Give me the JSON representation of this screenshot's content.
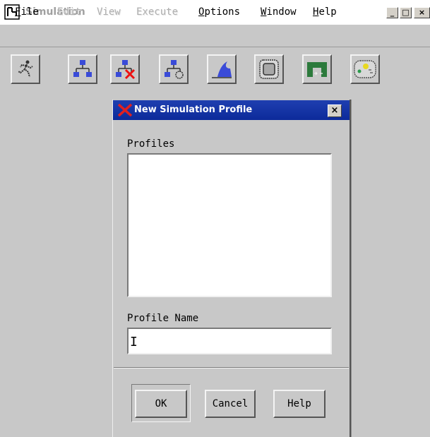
{
  "window": {
    "title": "Simulation",
    "controls": {
      "minimize": "_",
      "maximize": "□",
      "close": "×"
    }
  },
  "menubar": {
    "items": [
      {
        "label": "File",
        "underline": "F",
        "rest": "ile",
        "enabled": true
      },
      {
        "label": "Edit",
        "enabled": false
      },
      {
        "label": "View",
        "enabled": false
      },
      {
        "label": "Execute",
        "enabled": false
      },
      {
        "label": "Options",
        "underline": "O",
        "rest": "ptions",
        "enabled": true
      },
      {
        "label": "Window",
        "underline": "W",
        "rest": "indow",
        "enabled": true
      },
      {
        "label": "Help",
        "underline": "H",
        "rest": "elp",
        "enabled": true
      }
    ]
  },
  "toolbar": {
    "buttons": [
      {
        "icon": "running-man-icon"
      },
      {
        "icon": "hierarchy-icon"
      },
      {
        "icon": "hierarchy-delete-icon"
      },
      {
        "icon": "hierarchy-edit-icon"
      },
      {
        "icon": "waveform-icon"
      },
      {
        "icon": "chip-icon"
      },
      {
        "icon": "bridge-icon"
      },
      {
        "icon": "sun-settings-icon"
      }
    ]
  },
  "dialog": {
    "title": "New Simulation Profile",
    "close_label": "×",
    "profiles_label": "Profiles",
    "profiles": [],
    "profile_name_label": "Profile Name",
    "profile_name_value": "",
    "cursor": "I",
    "buttons": {
      "ok": "OK",
      "cancel": "Cancel",
      "help": "Help"
    }
  },
  "colors": {
    "dialog_title_bg": "#1a3aa8",
    "window_bg": "#c8c8c8",
    "icon_blue": "#3a4bd8"
  }
}
